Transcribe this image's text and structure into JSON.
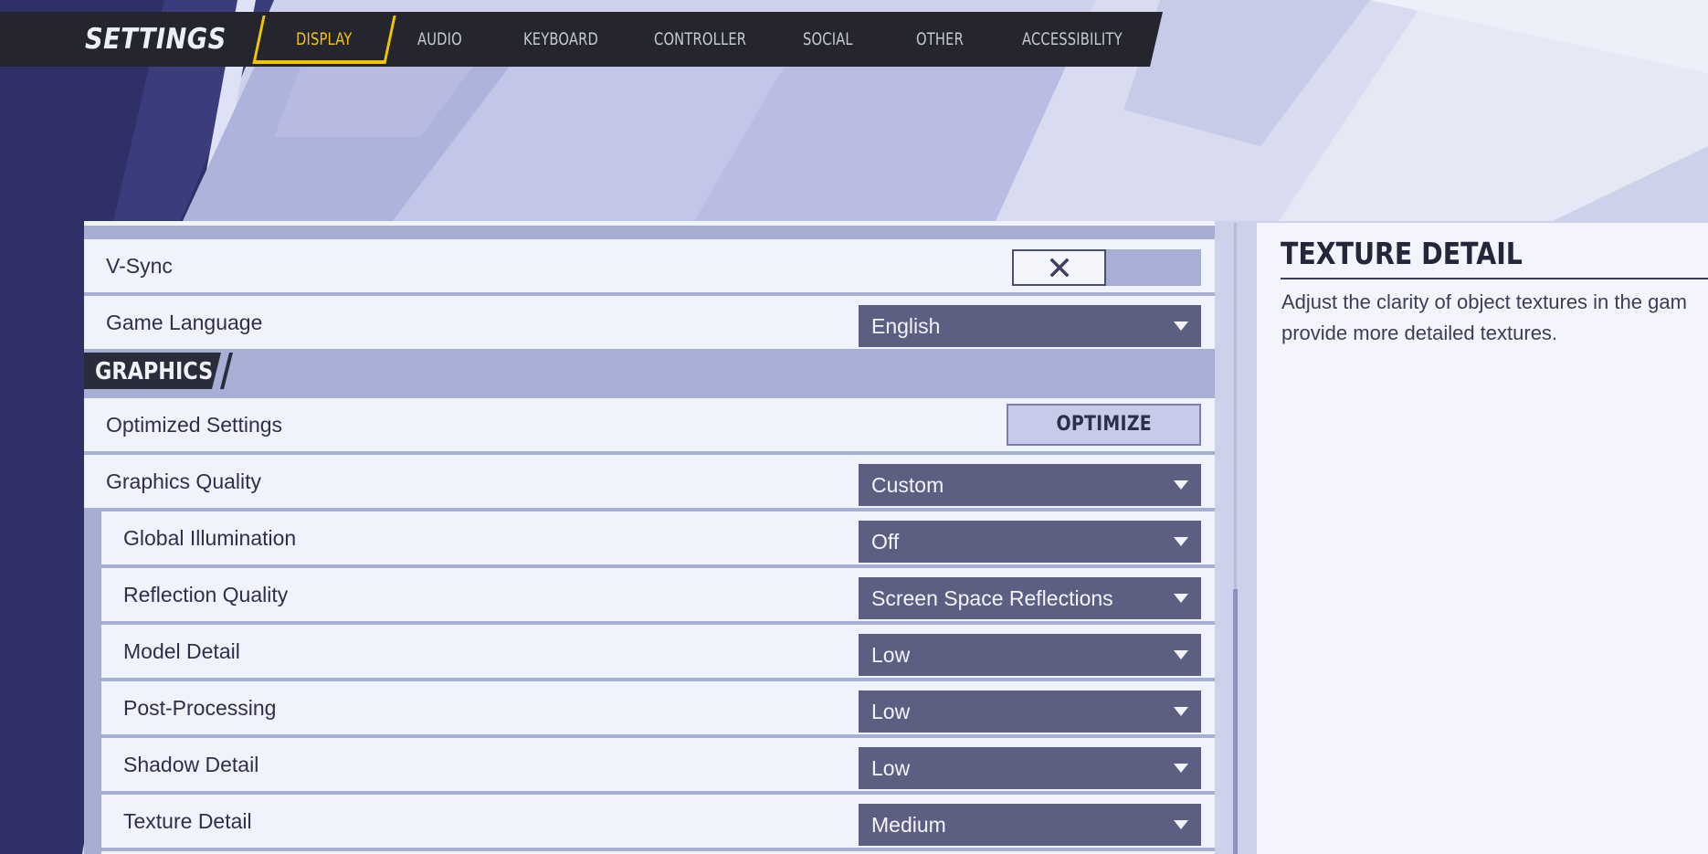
{
  "header": {
    "title": "SETTINGS",
    "tabs": [
      {
        "label": "DISPLAY",
        "active": true
      },
      {
        "label": "AUDIO",
        "active": false
      },
      {
        "label": "KEYBOARD",
        "active": false
      },
      {
        "label": "CONTROLLER",
        "active": false
      },
      {
        "label": "SOCIAL",
        "active": false
      },
      {
        "label": "OTHER",
        "active": false
      },
      {
        "label": "ACCESSIBILITY",
        "active": false
      }
    ]
  },
  "settings": {
    "vsync": {
      "label": "V-Sync",
      "enabled": false
    },
    "game_language": {
      "label": "Game Language",
      "value": "English"
    },
    "graphics_section": {
      "title": "GRAPHICS"
    },
    "optimized_settings": {
      "label": "Optimized Settings",
      "button": "OPTIMIZE"
    },
    "graphics_quality": {
      "label": "Graphics Quality",
      "value": "Custom"
    },
    "global_illumination": {
      "label": "Global Illumination",
      "value": "Off"
    },
    "reflection_quality": {
      "label": "Reflection Quality",
      "value": "Screen Space Reflections"
    },
    "model_detail": {
      "label": "Model Detail",
      "value": "Low"
    },
    "post_processing": {
      "label": "Post-Processing",
      "value": "Low"
    },
    "shadow_detail": {
      "label": "Shadow Detail",
      "value": "Low"
    },
    "texture_detail": {
      "label": "Texture Detail",
      "value": "Medium"
    }
  },
  "description": {
    "title": "TEXTURE DETAIL",
    "line1": "Adjust the clarity of object textures in the gam",
    "line2": "provide more detailed textures."
  },
  "colors": {
    "accent": "#f4c400",
    "dropdown": "#5c5f82",
    "row": "#f0f2fc",
    "nav": "#24252d"
  }
}
